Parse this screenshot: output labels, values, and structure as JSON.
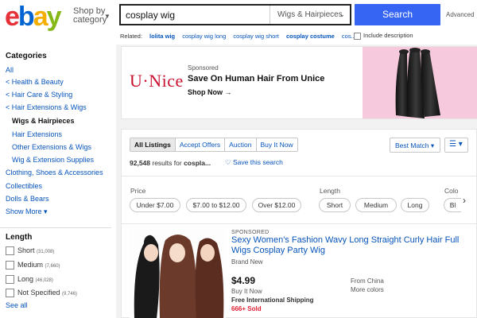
{
  "header": {
    "logo_letters": [
      "e",
      "b",
      "a",
      "y"
    ],
    "shop_by_line1": "Shop by",
    "shop_by_line2": "category",
    "search_value": "cosplay wig",
    "search_category": "Wigs & Hairpieces",
    "search_button": "Search",
    "advanced": "Advanced",
    "related_label": "Related:",
    "related": [
      "lolita wig",
      "cosplay wig long",
      "cosplay wig short",
      "cosplay costume",
      "cos..."
    ],
    "include_description": "Include description"
  },
  "sidebar": {
    "categories_heading": "Categories",
    "all": "All",
    "crumbs": [
      "< Health & Beauty",
      "< Hair Care & Styling",
      "< Hair Extensions & Wigs"
    ],
    "current": "Wigs & Hairpieces",
    "sub": [
      "Hair Extensions",
      "Other Extensions & Wigs",
      "Wig & Extension Supplies"
    ],
    "others": [
      "Clothing, Shoes & Accessories",
      "Collectibles",
      "Dolls & Bears"
    ],
    "show_more": "Show More ▾",
    "length_heading": "Length",
    "length_options": [
      {
        "label": "Short",
        "count": "(31,008)"
      },
      {
        "label": "Medium",
        "count": "(7,660)"
      },
      {
        "label": "Long",
        "count": "(46,028)"
      },
      {
        "label": "Not Specified",
        "count": "(9,746)"
      }
    ],
    "see_all": "See all"
  },
  "ad": {
    "brand": "UNice",
    "sponsored": "Sponsored",
    "title": "Save On Human Hair From Unice",
    "cta": "Shop Now →"
  },
  "results": {
    "tabs": [
      "All Listings",
      "Accept Offers",
      "Auction",
      "Buy It Now"
    ],
    "sort": "Best Match ▾",
    "view_icon": "list-view-icon",
    "count_number": "92,548",
    "count_text": "results for",
    "count_query": "cospla...",
    "save_search": "Save this search",
    "filters": {
      "price_label": "Price",
      "price_options": [
        "Under $7.00",
        "$7.00 to $12.00",
        "Over $12.00"
      ],
      "length_label": "Length",
      "length_options": [
        "Short",
        "Medium",
        "Long"
      ],
      "color_label": "Colo",
      "color_partial": "Bl"
    },
    "item": {
      "sponsored": "SPONSORED",
      "title": "Sexy Women's Fashion Wavy Long Straight Curly Hair Full Wigs Cosplay Party Wig",
      "condition": "Brand New",
      "price": "$4.99",
      "format": "Buy It Now",
      "shipping": "Free International Shipping",
      "sold": "666+ Sold",
      "from": "From China",
      "more": "More colors"
    }
  },
  "colors": {
    "link": "#0654ba",
    "search_button": "#3665f3",
    "sold": "#dd1e31",
    "ad_bg": "#f7c9dc",
    "unice": "#c8102e"
  }
}
